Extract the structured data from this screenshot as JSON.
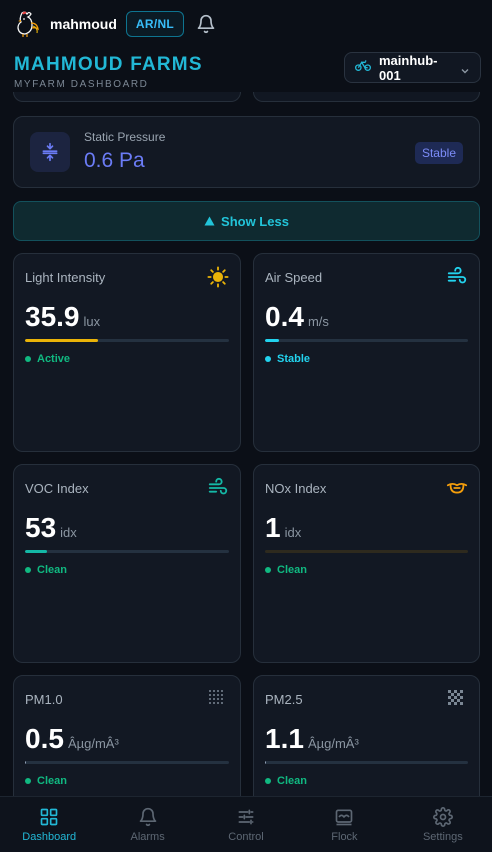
{
  "header": {
    "username": "mahmoud",
    "lang_label": "AR/NL",
    "farm_title": "MAHMOUD FARMS",
    "farm_subtitle": "MYFARM DASHBOARD",
    "hub": {
      "name": "mainhub-001",
      "icon": "bicycle-icon"
    }
  },
  "pressure": {
    "label": "Static Pressure",
    "value": "0.6 Pa",
    "badge": "Stable",
    "icon": "compress-icon"
  },
  "toggle": {
    "label": "Show Less",
    "icon": "triangle-up-icon"
  },
  "metrics": [
    {
      "id": "light",
      "label": "Light Intensity",
      "value": "35.9",
      "unit": "lux",
      "status": "Active",
      "level": 0.36,
      "icon": "sun-icon",
      "bar_color": "#eab308",
      "status_color": "#10b981"
    },
    {
      "id": "air-speed",
      "label": "Air Speed",
      "value": "0.4",
      "unit": "m/s",
      "status": "Stable",
      "level": 0.07,
      "icon": "wind-icon",
      "bar_color": "#22d3ee",
      "status_color": "#22d3ee"
    },
    {
      "id": "voc",
      "label": "VOC Index",
      "value": "53",
      "unit": "idx",
      "status": "Clean",
      "level": 0.11,
      "icon": "wind-icon",
      "bar_color": "#14b8a6",
      "status_color": "#10b981"
    },
    {
      "id": "nox",
      "label": "NOx Index",
      "value": "1",
      "unit": "idx",
      "status": "Clean",
      "level": 0.0,
      "icon": "mask-icon",
      "bar_color": "#f59e0b",
      "status_color": "#10b981"
    },
    {
      "id": "pm1",
      "label": "PM1.0",
      "value": "0.5",
      "unit": "Âµg/mÂ³",
      "status": "Clean",
      "level": 0.005,
      "icon": "dots-grid-icon",
      "bar_color": "#94a3b8",
      "status_color": "#10b981"
    },
    {
      "id": "pm25",
      "label": "PM2.5",
      "value": "1.1",
      "unit": "Âµg/mÂ³",
      "status": "Clean",
      "level": 0.005,
      "icon": "dots-diamond-icon",
      "bar_color": "#94a3b8",
      "status_color": "#10b981"
    }
  ],
  "nav": [
    {
      "label": "Dashboard",
      "icon": "grid-icon",
      "active": true
    },
    {
      "label": "Alarms",
      "icon": "bell-icon",
      "active": false
    },
    {
      "label": "Control",
      "icon": "sliders-icon",
      "active": false
    },
    {
      "label": "Flock",
      "icon": "flock-icon",
      "active": false
    },
    {
      "label": "Settings",
      "icon": "gear-icon",
      "active": false
    }
  ]
}
